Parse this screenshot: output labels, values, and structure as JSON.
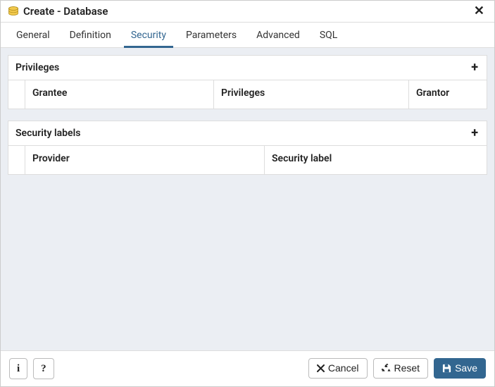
{
  "window": {
    "title": "Create - Database"
  },
  "tabs": {
    "general": "General",
    "definition": "Definition",
    "security": "Security",
    "parameters": "Parameters",
    "advanced": "Advanced",
    "sql": "SQL",
    "active": "security"
  },
  "panels": {
    "privileges": {
      "title": "Privileges",
      "columns": {
        "grantee": "Grantee",
        "privileges": "Privileges",
        "grantor": "Grantor"
      },
      "rows": []
    },
    "security_labels": {
      "title": "Security labels",
      "columns": {
        "provider": "Provider",
        "security_label": "Security label"
      },
      "rows": []
    }
  },
  "footer": {
    "info_label": "i",
    "help_label": "?",
    "cancel": "Cancel",
    "reset": "Reset",
    "save": "Save"
  }
}
